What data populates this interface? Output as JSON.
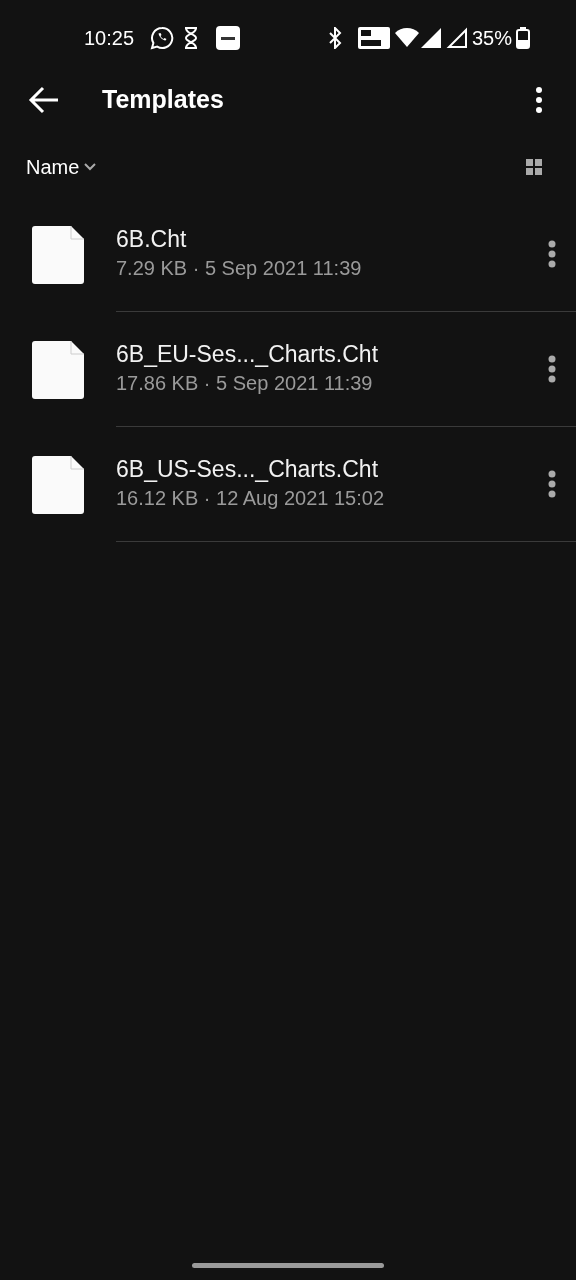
{
  "status_bar": {
    "time": "10:25",
    "battery": "35%"
  },
  "app_bar": {
    "title": "Templates"
  },
  "sort": {
    "label": "Name"
  },
  "files": [
    {
      "name": "6B.Cht",
      "details": "7.29 KB · 5 Sep 2021 11:39"
    },
    {
      "name": "6B_EU-Ses..._Charts.Cht",
      "details": "17.86 KB · 5 Sep 2021 11:39"
    },
    {
      "name": "6B_US-Ses..._Charts.Cht",
      "details": "16.12 KB · 12 Aug 2021 15:02"
    }
  ]
}
